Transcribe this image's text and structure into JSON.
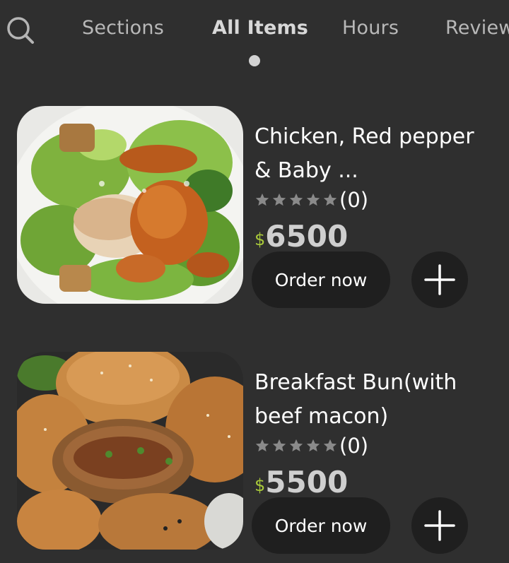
{
  "nav": {
    "search_icon": "search-icon",
    "tabs": [
      {
        "label": "Sections",
        "active": false
      },
      {
        "label": "All Items",
        "active": true
      },
      {
        "label": "Hours",
        "active": false
      },
      {
        "label": "Reviews",
        "active": false
      }
    ]
  },
  "items": [
    {
      "name": "Chicken, Red pepper & Baby ...",
      "rating_stars": 0,
      "rating_count": "(0)",
      "currency": "$",
      "price": "6500",
      "order_label": "Order now",
      "add_icon": "plus-icon"
    },
    {
      "name": "Breakfast Bun(with beef macon)",
      "rating_stars": 0,
      "rating_count": "(0)",
      "currency": "$",
      "price": "5500",
      "order_label": "Order now",
      "add_icon": "plus-icon"
    }
  ],
  "colors": {
    "background": "#2f2f2f",
    "button_bg": "#1f1f1f",
    "currency_accent": "#a8c83a",
    "star_empty": "#8a8a8a"
  }
}
